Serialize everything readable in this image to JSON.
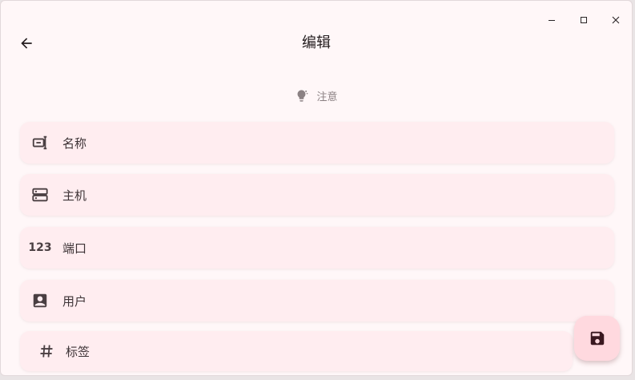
{
  "window": {
    "controls": [
      "minimize",
      "maximize",
      "close"
    ]
  },
  "header": {
    "title": "编辑",
    "back_icon": "arrow-back-icon"
  },
  "notice": {
    "icon": "lightbulb-icon",
    "text": "注意"
  },
  "fields": [
    {
      "icon": "name-icon",
      "label": "名称"
    },
    {
      "icon": "host-icon",
      "label": "主机"
    },
    {
      "icon": "number-icon",
      "icon_text": "123",
      "label": "端口"
    },
    {
      "icon": "user-icon",
      "label": "用户"
    },
    {
      "icon": "hash-icon",
      "label": "标签"
    }
  ],
  "fab": {
    "icon": "save-icon"
  },
  "colors": {
    "background": "#fff7f8",
    "field_background": "#ffedf0",
    "fab_background": "#ffd9df",
    "text": "#231c1e"
  }
}
